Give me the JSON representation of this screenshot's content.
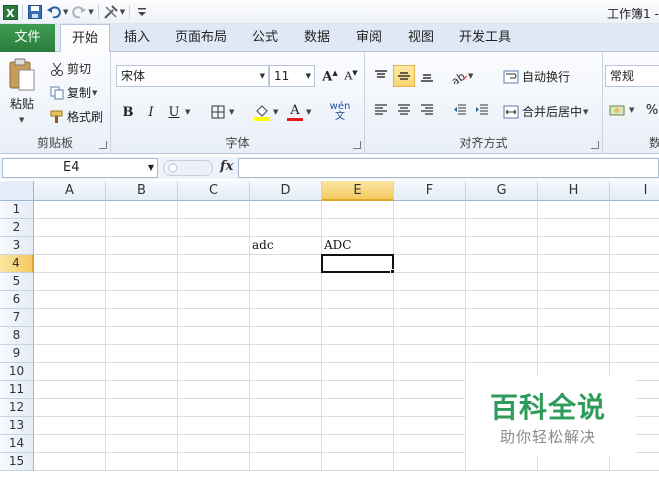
{
  "window": {
    "title": "工作簿1 -"
  },
  "tabs": [
    "文件",
    "开始",
    "插入",
    "页面布局",
    "公式",
    "数据",
    "审阅",
    "视图",
    "开发工具"
  ],
  "clipboard": {
    "paste": "粘贴",
    "cut": "剪切",
    "copy": "复制",
    "format_painter": "格式刷",
    "label": "剪贴板"
  },
  "font": {
    "name": "宋体",
    "size": "11",
    "label": "字体",
    "bold": "B",
    "italic": "I",
    "underline": "U",
    "color_letter": "A",
    "phonetic": "wén 文"
  },
  "alignment": {
    "wrap": "自动换行",
    "merge": "合并后居中",
    "label": "对齐方式"
  },
  "number": {
    "format": "常规",
    "label": "数",
    "percent": "%"
  },
  "formula_bar": {
    "cell_ref": "E4",
    "fx": "fx",
    "value": ""
  },
  "columns": [
    "A",
    "B",
    "C",
    "D",
    "E",
    "F",
    "G",
    "H",
    "I"
  ],
  "rows": [
    "1",
    "2",
    "3",
    "4",
    "5",
    "6",
    "7",
    "8",
    "9",
    "10",
    "11",
    "12",
    "13",
    "14",
    "15"
  ],
  "active_cell": "E4",
  "cells": {
    "D3": "adc",
    "E3": "ADC"
  },
  "watermark": {
    "title": "百科全说",
    "subtitle": "助你轻松解决"
  }
}
